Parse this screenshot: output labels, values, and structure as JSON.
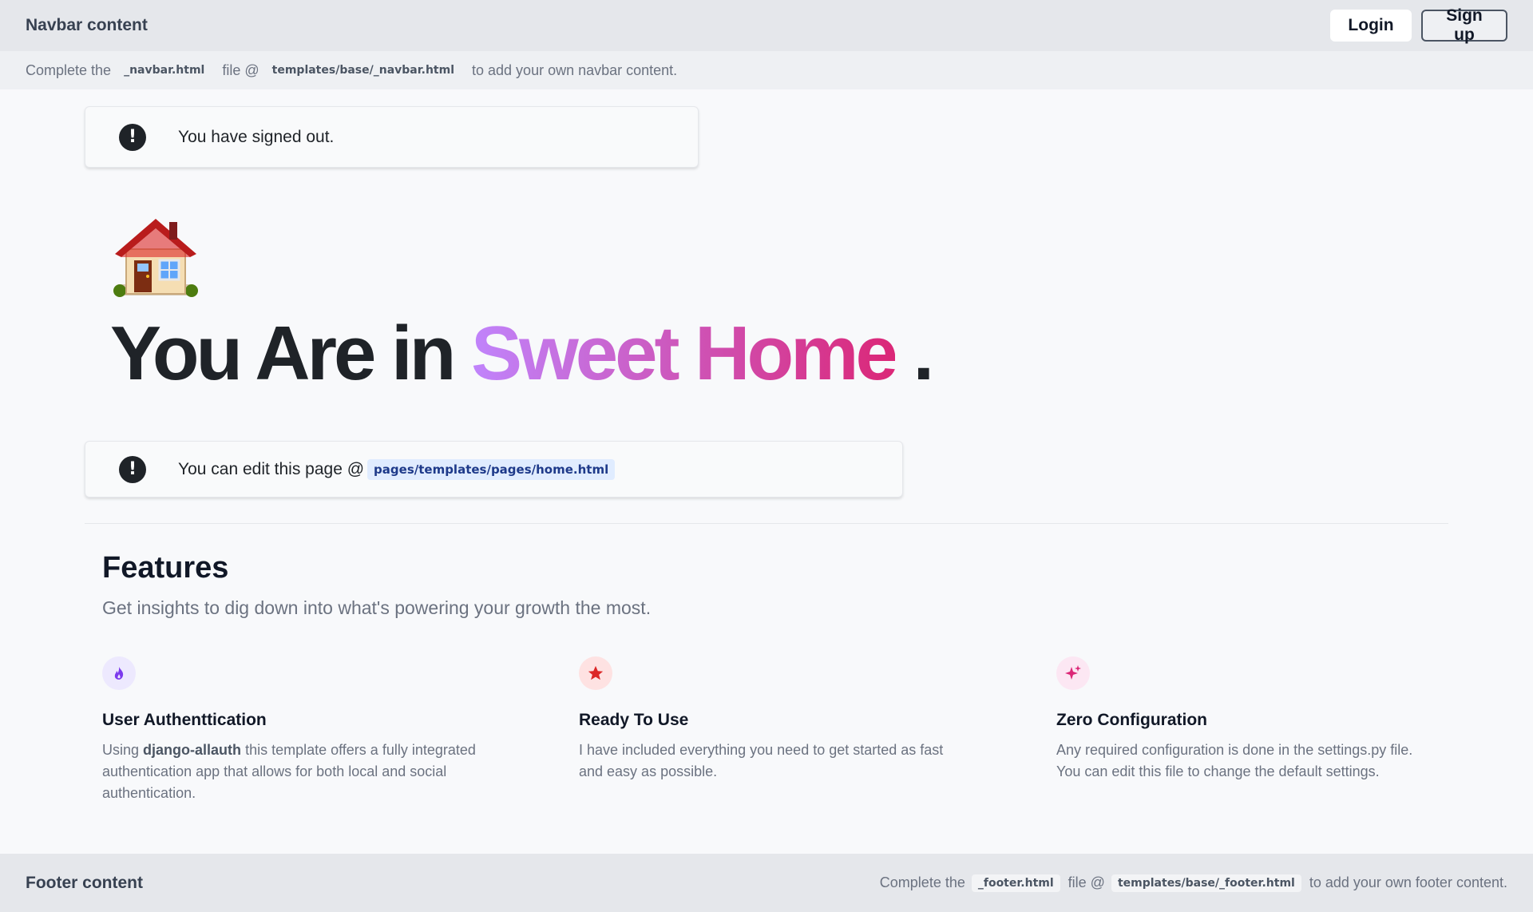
{
  "navbar": {
    "brand": "Navbar content",
    "login_label": "Login",
    "signup_label": "Sign up"
  },
  "subbar": {
    "prefix": "Complete the",
    "file": "_navbar.html",
    "mid": "file @",
    "path": "templates/base/_navbar.html",
    "suffix": "to add your own navbar content."
  },
  "alerts": {
    "signed_out": "You have signed out.",
    "edit_prefix": "You can edit this page @",
    "edit_path": "pages/templates/pages/home.html"
  },
  "hero": {
    "icon": "house-emoji",
    "title_start": "You Are in",
    "title_highlight": "Sweet Home",
    "title_end": "."
  },
  "features": {
    "title": "Features",
    "subtitle": "Get insights to dig down into what's powering your growth the most.",
    "items": [
      {
        "icon": "fire-icon",
        "icon_color": "#7c3aed",
        "icon_bg": "#ede9fe",
        "title": "User Authenttication",
        "desc_prefix": "Using",
        "desc_bold": "django-allauth",
        "desc_rest": "this template offers a fully integrated authentication app that allows for both local and social authentication."
      },
      {
        "icon": "star-icon",
        "icon_color": "#dc2626",
        "icon_bg": "#fee2e2",
        "title": "Ready To Use",
        "desc": "I have included everything you need to get started as fast and easy as possible."
      },
      {
        "icon": "sparkles-icon",
        "icon_color": "#db2777",
        "icon_bg": "#fce7f3",
        "title": "Zero Configuration",
        "desc": "Any required configuration is done in the settings.py file. You can edit this file to change the default settings."
      }
    ]
  },
  "footer": {
    "brand": "Footer content",
    "prefix": "Complete the",
    "file": "_footer.html",
    "mid": "file @",
    "path": "templates/base/_footer.html",
    "suffix": "to add your own footer content."
  }
}
